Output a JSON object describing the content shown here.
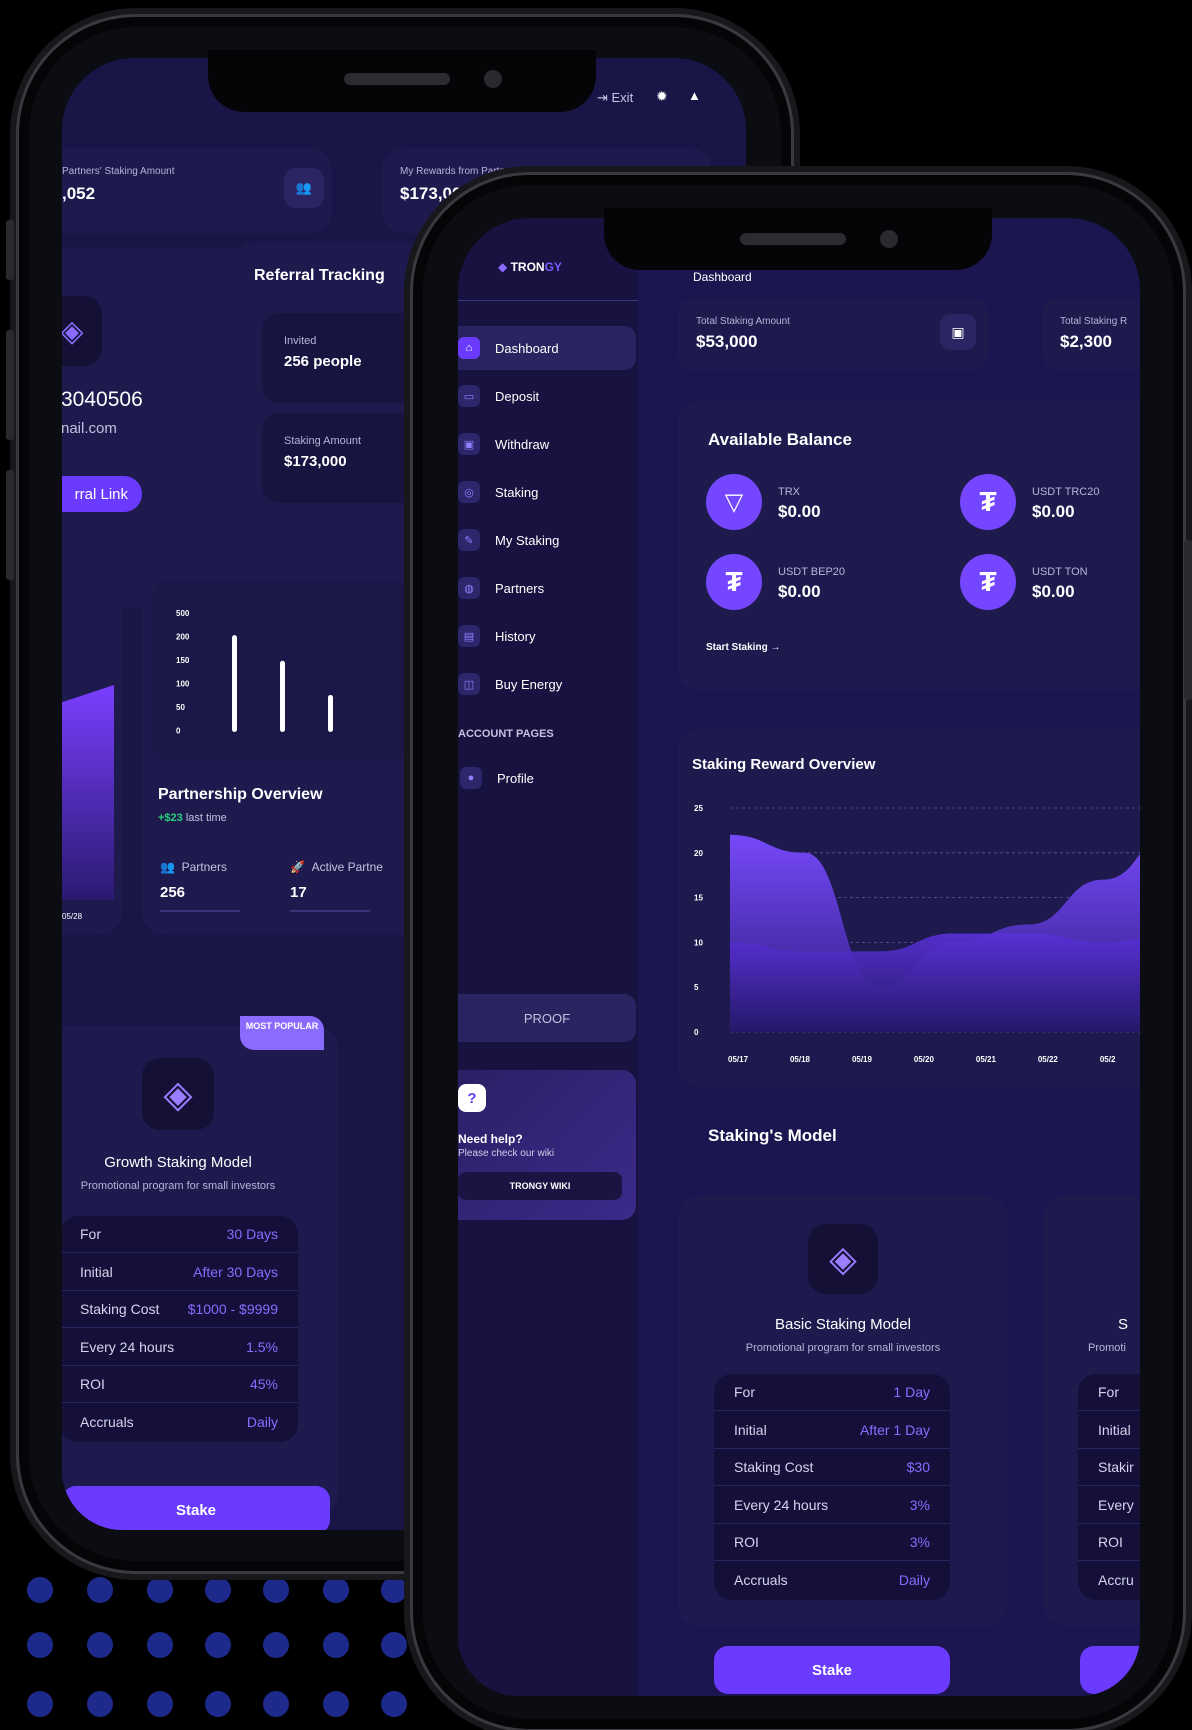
{
  "colors": {
    "accent": "#6a3bff",
    "positive": "#27d07a",
    "background": "#1a1547"
  },
  "back_phone": {
    "header": {
      "exit_label": "Exit"
    },
    "stats": [
      {
        "label": "Partners' Staking Amount",
        "value": ",052"
      },
      {
        "label": "My Rewards from Partners",
        "value": "$173,00"
      }
    ],
    "profile": {
      "id": "3040506",
      "email": "nail.com",
      "referral_button": "rral Link"
    },
    "referral": {
      "title": "Referral Tracking",
      "invited_label": "Invited",
      "invited_value": "256 people",
      "staking_label": "Staking Amount",
      "staking_value": "$173,000"
    },
    "partnership": {
      "title": "Partnership Overview",
      "delta": "+$23",
      "delta_suffix": " last time",
      "partners_label": "Partners",
      "partners_value": "256",
      "active_label": "Active Partne",
      "active_value": "17",
      "yticks": [
        "500",
        "200",
        "150",
        "100",
        "50",
        "0"
      ],
      "left_xtick": "05/28"
    },
    "chart_data": {
      "type": "bar",
      "values": [
        170,
        125,
        65
      ],
      "ylim": [
        0,
        200
      ]
    },
    "model": {
      "badge": "MOST POPULAR",
      "title": "Growth Staking Model",
      "subtitle": "Promotional program for small investors",
      "rows": [
        {
          "k": "For",
          "v": "30 Days"
        },
        {
          "k": "Initial",
          "v": "After 30 Days"
        },
        {
          "k": "Staking Cost",
          "v": "$1000 - $9999"
        },
        {
          "k": "Every 24 hours",
          "v": "1.5%"
        },
        {
          "k": "ROI",
          "v": "45%"
        },
        {
          "k": "Accruals",
          "v": "Daily"
        }
      ],
      "button": "Stake"
    }
  },
  "front_phone": {
    "logo": {
      "text_a": "TRON",
      "text_b": "GY"
    },
    "page_title": "Dashboard",
    "nav": [
      {
        "label": "Dashboard",
        "icon": "home-icon"
      },
      {
        "label": "Deposit",
        "icon": "card-icon"
      },
      {
        "label": "Withdraw",
        "icon": "wallet-icon"
      },
      {
        "label": "Staking",
        "icon": "stack-icon"
      },
      {
        "label": "My Staking",
        "icon": "wrench-icon"
      },
      {
        "label": "Partners",
        "icon": "users-icon"
      },
      {
        "label": "History",
        "icon": "history-icon"
      },
      {
        "label": "Buy Energy",
        "icon": "energy-icon"
      }
    ],
    "account_pages_label": "ACCOUNT PAGES",
    "profile_label": "Profile",
    "proof_button": "PROOF",
    "help": {
      "title": "Need help?",
      "text": "Please check our wiki",
      "button": "TRONGY WIKI"
    },
    "stats": [
      {
        "label": "Total Staking Amount",
        "value": "$53,000"
      },
      {
        "label": "Total Staking R",
        "value": "$2,300"
      }
    ],
    "balance": {
      "title": "Available Balance",
      "items": [
        {
          "name": "TRX",
          "value": "$0.00"
        },
        {
          "name": "USDT TRC20",
          "value": "$0.00"
        },
        {
          "name": "USDT BEP20",
          "value": "$0.00"
        },
        {
          "name": "USDT TON",
          "value": "$0.00"
        }
      ],
      "start_link": "Start Staking"
    },
    "reward": {
      "title": "Staking Reward Overview"
    },
    "chart_data": {
      "type": "area",
      "x": [
        "05/17",
        "05/18",
        "05/19",
        "05/20",
        "05/21",
        "05/22",
        "05/2"
      ],
      "yticks": [
        "25",
        "20",
        "15",
        "10",
        "5",
        "0"
      ],
      "ylim": [
        0,
        25
      ],
      "series": [
        {
          "values": [
            22,
            20,
            5,
            10,
            12,
            17,
            23
          ]
        },
        {
          "values": [
            10,
            9,
            9,
            11,
            11,
            10,
            11
          ]
        }
      ]
    },
    "models_title": "Staking's Model",
    "model": {
      "title": "Basic Staking Model",
      "subtitle": "Promotional program for small investors",
      "rows": [
        {
          "k": "For",
          "v": "1 Day"
        },
        {
          "k": "Initial",
          "v": "After 1 Day"
        },
        {
          "k": "Staking Cost",
          "v": "$30"
        },
        {
          "k": "Every 24 hours",
          "v": "3%"
        },
        {
          "k": "ROI",
          "v": "3%"
        },
        {
          "k": "Accruals",
          "v": "Daily"
        }
      ],
      "button": "Stake"
    },
    "model2": {
      "title": "S",
      "subtitle": "Promoti",
      "rows": [
        "For",
        "Initial",
        "Stakir",
        "Every",
        "ROI",
        "Accru"
      ]
    }
  }
}
